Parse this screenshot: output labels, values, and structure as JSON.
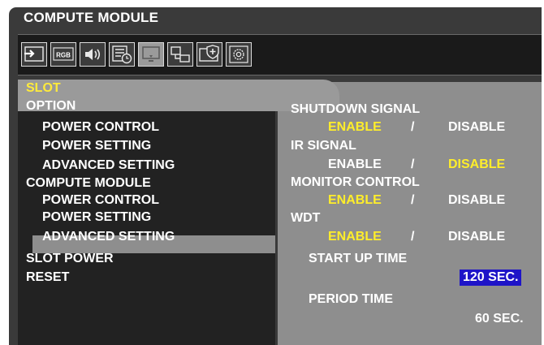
{
  "osd": {
    "title": "COMPUTE MODULE"
  },
  "toolbar": {
    "icons": [
      "input-icon",
      "rgb-icon",
      "audio-icon",
      "schedule-icon",
      "display-icon",
      "network-icon",
      "protect-icon",
      "settings-icon"
    ],
    "rgb_label": "RGB",
    "active_icon": "display-icon"
  },
  "menu": {
    "slot": "SLOT",
    "option": "OPTION",
    "option_power_control": "POWER CONTROL",
    "option_power_setting": "POWER SETTING",
    "option_advanced_setting": "ADVANCED SETTING",
    "compute_module": "COMPUTE MODULE",
    "cm_power_control": "POWER CONTROL",
    "cm_power_setting": "POWER SETTING",
    "cm_advanced_setting": "ADVANCED SETTING",
    "slot_power": "SLOT POWER",
    "reset": "RESET"
  },
  "settings": {
    "shutdown_signal": {
      "label": "SHUTDOWN SIGNAL",
      "enable": "ENABLE",
      "sep": "/",
      "disable": "DISABLE",
      "selected": "enable"
    },
    "ir_signal": {
      "label": "IR SIGNAL",
      "enable": "ENABLE",
      "sep": "/",
      "disable": "DISABLE",
      "selected": "disable"
    },
    "monitor_control": {
      "label": "MONITOR CONTROL",
      "enable": "ENABLE",
      "sep": "/",
      "disable": "DISABLE",
      "selected": "enable"
    },
    "wdt": {
      "label": "WDT",
      "enable": "ENABLE",
      "sep": "/",
      "disable": "DISABLE",
      "selected": "enable"
    },
    "start_up_time": {
      "label": "START UP TIME",
      "value": "120 SEC."
    },
    "period_time": {
      "label": "PERIOD TIME",
      "value": "60 SEC."
    }
  },
  "colors": {
    "selected_option": "#ffee2a",
    "highlight": "#1e14c8",
    "panel_dark": "#222222",
    "panel_gray": "#8e8e8e"
  }
}
